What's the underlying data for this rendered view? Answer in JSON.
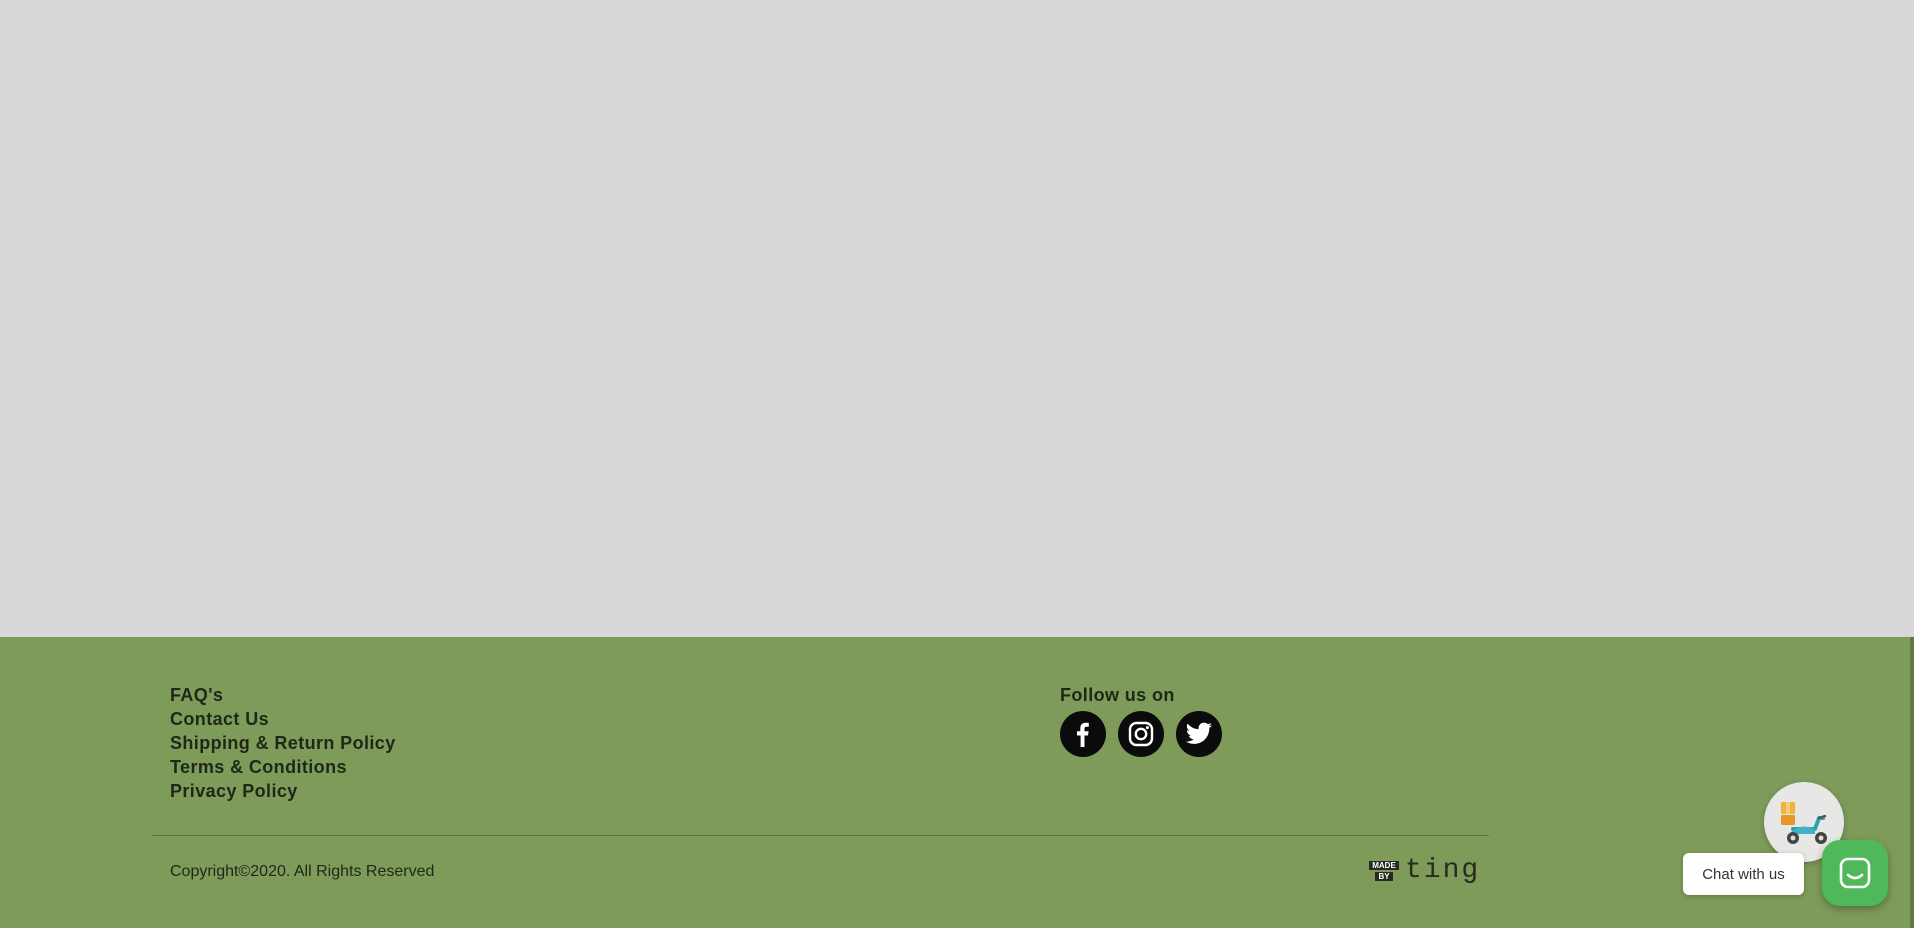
{
  "footer": {
    "links": [
      {
        "label": "FAQ's"
      },
      {
        "label": "Contact Us"
      },
      {
        "label": "Shipping & Return Policy"
      },
      {
        "label": "Terms & Conditions"
      },
      {
        "label": "Privacy Policy"
      }
    ],
    "follow_title": "Follow us on",
    "social": [
      {
        "icon": "facebook-icon"
      },
      {
        "icon": "instagram-icon"
      },
      {
        "icon": "twitter-icon"
      }
    ],
    "copyright": "Copyright©2020. All Rights Reserved",
    "made_by": {
      "badge_top": "MADE",
      "badge_bottom": "BY",
      "word": "ting"
    }
  },
  "chat": {
    "label": "Chat with us",
    "delivery_icon": "delivery-scooter-icon",
    "chat_icon": "chat-icon"
  },
  "colors": {
    "content_bg": "#d8d8d8",
    "footer_bg": "#7e9b5a",
    "chat_green": "#4fb95a"
  }
}
